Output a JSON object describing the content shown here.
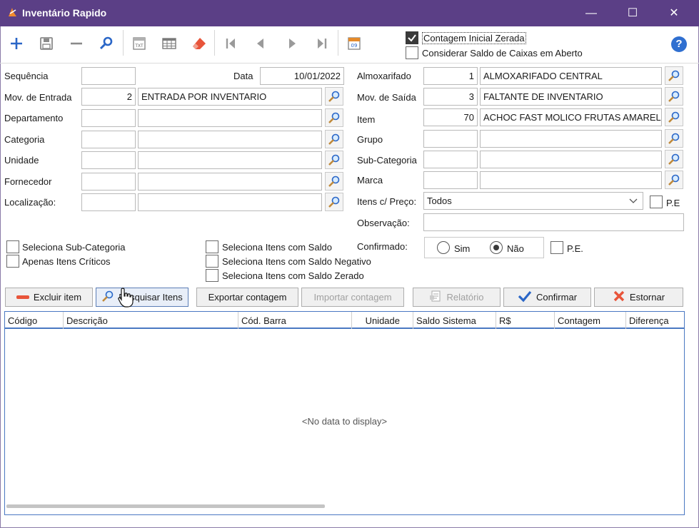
{
  "window": {
    "title": "Inventário Rapido",
    "minimize": "—",
    "maximize": "☐",
    "close": "✕"
  },
  "toolbar": {
    "contagem_inicial_label": "Contagem Inicial Zerada",
    "considerar_saldo_label": "Considerar Saldo de Caixas em Aberto",
    "help_label": "?"
  },
  "form": {
    "sequencia_label": "Sequência",
    "sequencia_value": "",
    "data_label": "Data",
    "data_value": "10/01/2022",
    "mov_entrada_label": "Mov. de Entrada",
    "mov_entrada_code": "2",
    "mov_entrada_desc": "ENTRADA POR INVENTARIO",
    "departamento_label": "Departamento",
    "categoria_label": "Categoria",
    "unidade_label": "Unidade",
    "fornecedor_label": "Fornecedor",
    "localizacao_label": "Localização:",
    "almoxarifado_label": "Almoxarifado",
    "almoxarifado_code": "1",
    "almoxarifado_desc": "ALMOXARIFADO CENTRAL",
    "mov_saida_label": "Mov. de Saída",
    "mov_saida_code": "3",
    "mov_saida_desc": "FALTANTE DE INVENTARIO",
    "item_label": "Item",
    "item_code": "70",
    "item_desc": "ACHOC FAST MOLICO FRUTAS AMAREL.",
    "grupo_label": "Grupo",
    "subcategoria_label": "Sub-Categoria",
    "marca_label": "Marca",
    "itens_preco_label": "Itens c/ Preço:",
    "itens_preco_value": "Todos",
    "pe_label": "P.E",
    "observacao_label": "Observação:",
    "confirmado_label": "Confirmado:",
    "sim_label": "Sim",
    "nao_label": "Não",
    "pe2_label": "P.E."
  },
  "options": {
    "seleciona_subcat": "Seleciona Sub-Categoria",
    "apenas_criticos": "Apenas Itens Críticos",
    "saldo": "Seleciona Itens com Saldo",
    "saldo_negativo": "Seleciona Itens com Saldo Negativo",
    "saldo_zerado": "Seleciona Itens com Saldo Zerado"
  },
  "buttons": {
    "excluir": "Excluir item",
    "pesquisar": "Pesquisar Itens",
    "exportar": "Exportar contagem",
    "importar": "Importar contagem",
    "relatorio": "Relatório",
    "confirmar": "Confirmar",
    "estornar": "Estornar"
  },
  "grid": {
    "columns": [
      "Código",
      "Descrição",
      "Cód. Barra",
      "Unidade",
      "Saldo Sistema",
      "R$",
      "Contagem",
      "Diferença"
    ],
    "empty_text": "<No data to display>"
  },
  "colors": {
    "titlebar": "#5b3f86",
    "grid_border": "#4a78c2",
    "toolbar_blue": "#2a66c7",
    "help_blue": "#2f6fd0"
  }
}
